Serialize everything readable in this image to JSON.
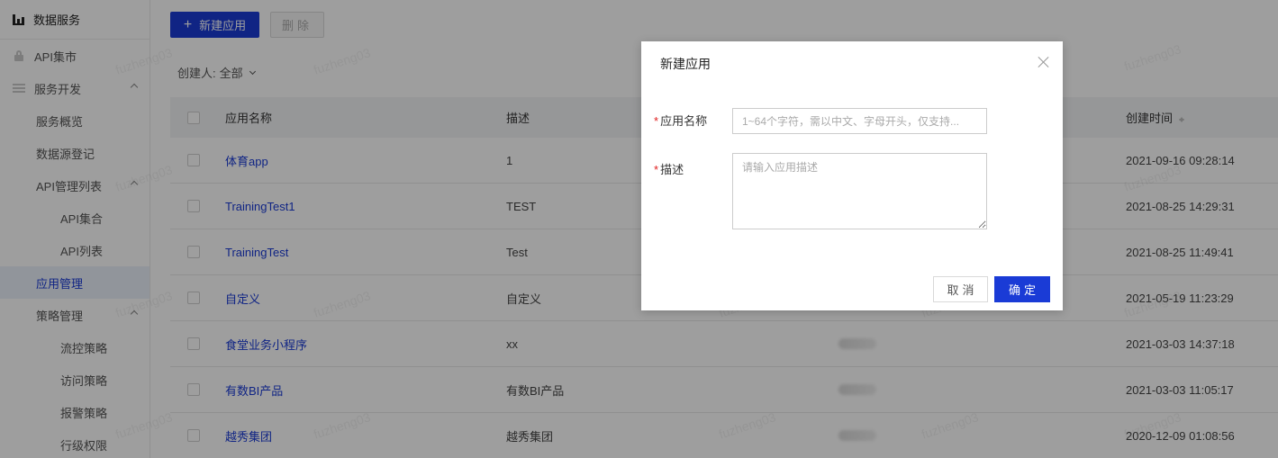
{
  "sidebar": {
    "brand": "数据服务",
    "items": [
      {
        "label": "API集市",
        "level": 1,
        "icon": "lock-icon"
      },
      {
        "label": "服务开发",
        "level": 1,
        "icon": "list-icon",
        "expandable": true
      },
      {
        "label": "服务概览",
        "level": 2
      },
      {
        "label": "数据源登记",
        "level": 2
      },
      {
        "label": "API管理列表",
        "level": 2,
        "expandable": true
      },
      {
        "label": "API集合",
        "level": 3
      },
      {
        "label": "API列表",
        "level": 3
      },
      {
        "label": "应用管理",
        "level": 2,
        "active": true
      },
      {
        "label": "策略管理",
        "level": 2,
        "expandable": true
      },
      {
        "label": "流控策略",
        "level": 3
      },
      {
        "label": "访问策略",
        "level": 3
      },
      {
        "label": "报警策略",
        "level": 3
      },
      {
        "label": "行级权限",
        "level": 3
      }
    ]
  },
  "toolbar": {
    "new_label": "新建应用",
    "delete_label": "删除"
  },
  "filter": {
    "label": "创建人:",
    "value": "全部"
  },
  "table": {
    "headers": {
      "name": "应用名称",
      "desc": "描述",
      "time": "创建时间"
    },
    "rows": [
      {
        "name": "体育app",
        "desc": "1",
        "time": "2021-09-16 09:28:14"
      },
      {
        "name": "TrainingTest1",
        "desc": "TEST",
        "time": "2021-08-25 14:29:31"
      },
      {
        "name": "TrainingTest",
        "desc": "Test",
        "time": "2021-08-25 11:49:41"
      },
      {
        "name": "自定义",
        "desc": "自定义",
        "time": "2021-05-19 11:23:29"
      },
      {
        "name": "食堂业务小程序",
        "desc": "xx",
        "time": "2021-03-03 14:37:18"
      },
      {
        "name": "有数BI产品",
        "desc": "有数BI产品",
        "time": "2021-03-03 11:05:17"
      },
      {
        "name": "越秀集团",
        "desc": "越秀集团",
        "time": "2020-12-09 01:08:56"
      }
    ]
  },
  "watermark": "fuzheng03",
  "modal": {
    "title": "新建应用",
    "name_label": "应用名称",
    "name_placeholder": "1~64个字符，需以中文、字母开头，仅支持...",
    "desc_label": "描述",
    "desc_placeholder": "请输入应用描述",
    "cancel_label": "取消",
    "ok_label": "确定",
    "required_mark": "*"
  },
  "colors": {
    "primary": "#1a3bd6",
    "required": "#e02020"
  }
}
